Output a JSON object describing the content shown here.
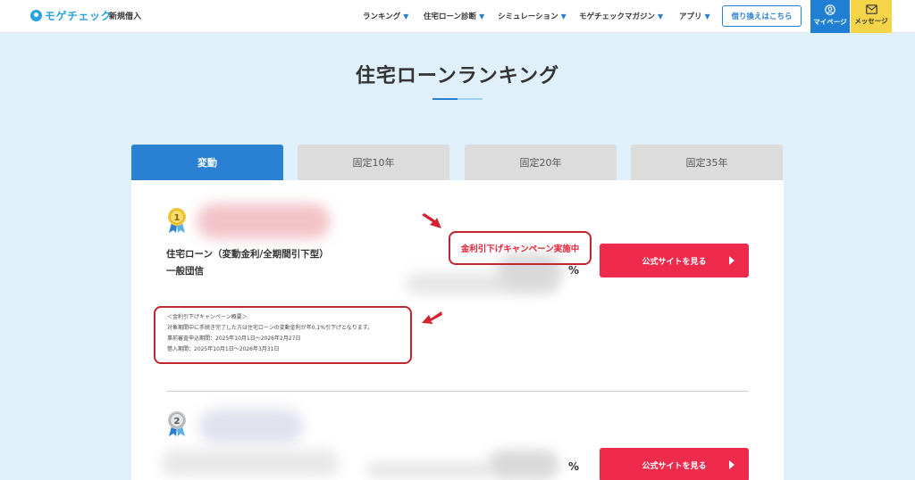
{
  "header": {
    "logo_text": "モゲチェック",
    "logo_sub": "新規借入",
    "nav": [
      {
        "label": "ランキング"
      },
      {
        "label": "住宅ローン診断"
      },
      {
        "label": "シミュレーション"
      },
      {
        "label": "モゲチェックマガジン"
      },
      {
        "label": "アプリ"
      }
    ],
    "refinance_label": "借り換えはこちら",
    "mypage_label": "マイページ",
    "message_label": "メッセージ"
  },
  "page_title": "住宅ローンランキング",
  "tabs": [
    {
      "label": "変動",
      "active": true
    },
    {
      "label": "固定10年",
      "active": false
    },
    {
      "label": "固定20年",
      "active": false
    },
    {
      "label": "固定35年",
      "active": false
    }
  ],
  "rankings": [
    {
      "rank": "1",
      "product_line1": "住宅ローン（変動金利/全期間引下型）",
      "product_line2": "一般団信",
      "percent_symbol": "%",
      "campaign_badge": "金利引下げキャンペーン実施中",
      "button_label": "公式サイトを見る",
      "campaign_lines": [
        "＜金利引下げキャンペーン概要＞",
        "対象期間中に手続き完了した方は住宅ローンの変動金利が年0.1%引下げとなります。",
        "事前審査申込期間：2025年10月1日～2026年2月27日",
        "借入期間：2025年10月1日～2026年3月31日"
      ]
    },
    {
      "rank": "2",
      "percent_symbol": "%",
      "button_label": "公式サイトを見る"
    }
  ],
  "colors": {
    "accent_blue": "#2a80d2",
    "cta_red": "#ee2a4d",
    "highlight_red": "#c0262d",
    "background": "#dff0fb",
    "message_yellow": "#f5d44a"
  }
}
